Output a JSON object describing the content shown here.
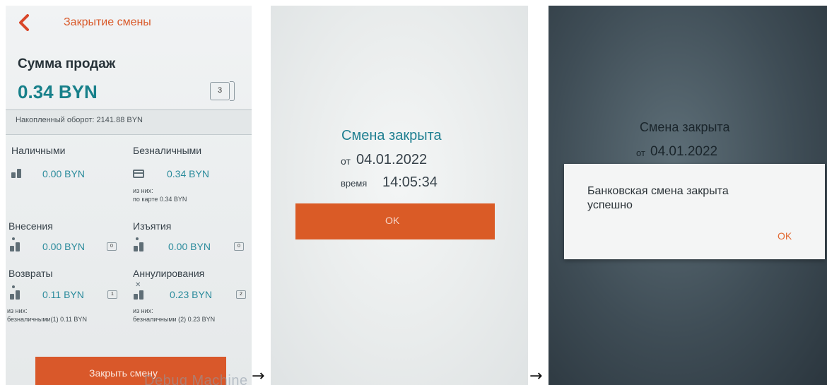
{
  "screen1": {
    "title": "Закрытие смены",
    "sales_sum_label": "Сумма продаж",
    "sales_sum_value": "0.34 BYN",
    "receipt_count": "3",
    "accumulated_turnover": "Накопленный оборот: 2141.88 BYN",
    "cash": {
      "label": "Наличными",
      "amount": "0.00 BYN"
    },
    "cashless": {
      "label": "Безналичными",
      "amount": "0.34 BYN",
      "note_line1": "из них:",
      "note_line2": "по карте 0.34 BYN"
    },
    "deposits": {
      "label": "Внесения",
      "amount": "0.00 BYN",
      "count": "0"
    },
    "withdrawals": {
      "label": "Изъятия",
      "amount": "0.00 BYN",
      "count": "0"
    },
    "returns": {
      "label": "Возвраты",
      "amount": "0.11 BYN",
      "count": "1",
      "note_line1": "из них:",
      "note_line2": "безналичными(1) 0.11 BYN"
    },
    "cancellations": {
      "label": "Аннулирования",
      "amount": "0.23 BYN",
      "count": "2",
      "note_line1": "из них:",
      "note_line2": "безналичными (2) 0.23 BYN"
    },
    "close_button": "Закрыть смену",
    "watermark": "Debug Machine"
  },
  "arrow": "→",
  "screen2": {
    "title": "Смена закрыта",
    "date_prefix": "от",
    "date": "04.01.2022",
    "time_prefix": "время",
    "time": "14:05:34",
    "ok_button": "OK"
  },
  "screen3": {
    "title": "Смена закрыта",
    "date_prefix": "от",
    "date": "04.01.2022",
    "dialog_message": "Банковская смена закрыта успешно",
    "dialog_ok": "OK"
  },
  "colors": {
    "accent_orange": "#d9582a",
    "teal": "#2b8b9c",
    "dark_text": "#37424a"
  }
}
